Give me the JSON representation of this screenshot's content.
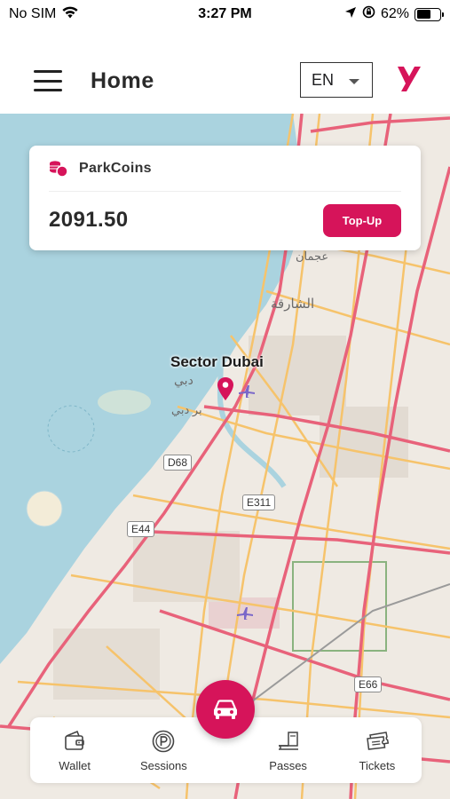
{
  "status_bar": {
    "carrier": "No SIM",
    "time": "3:27 PM",
    "battery": "62%",
    "battery_level": 0.62,
    "icons": [
      "wifi-icon",
      "location-arrow-icon",
      "orientation-lock-icon",
      "battery-icon"
    ]
  },
  "header": {
    "title": "Home",
    "language": "EN",
    "menu_icon": "hamburger-icon",
    "logo_icon": "brand-logo"
  },
  "coins": {
    "label": "ParkCoins",
    "balance": "2091.50",
    "topup_label": "Top-Up",
    "icon": "coins-icon"
  },
  "map": {
    "sector_label": "Sector Dubai",
    "place_labels": [
      "عجمان",
      "الشارقة",
      "دبي",
      "بر دبي"
    ],
    "road_shields": [
      "D68",
      "E311",
      "E44",
      "E66"
    ],
    "water_color": "#a9d3df",
    "land_color": "#efeae3",
    "highway_color": "#e8627a",
    "road_color": "#f6c36b"
  },
  "nav": {
    "items": [
      {
        "label": "Wallet",
        "icon": "wallet-icon"
      },
      {
        "label": "Sessions",
        "icon": "parking-sessions-icon"
      },
      {
        "label": "Passes",
        "icon": "passes-icon"
      },
      {
        "label": "Tickets",
        "icon": "tickets-icon"
      }
    ],
    "fab_icon": "car-icon"
  },
  "colors": {
    "accent": "#d6145a"
  }
}
